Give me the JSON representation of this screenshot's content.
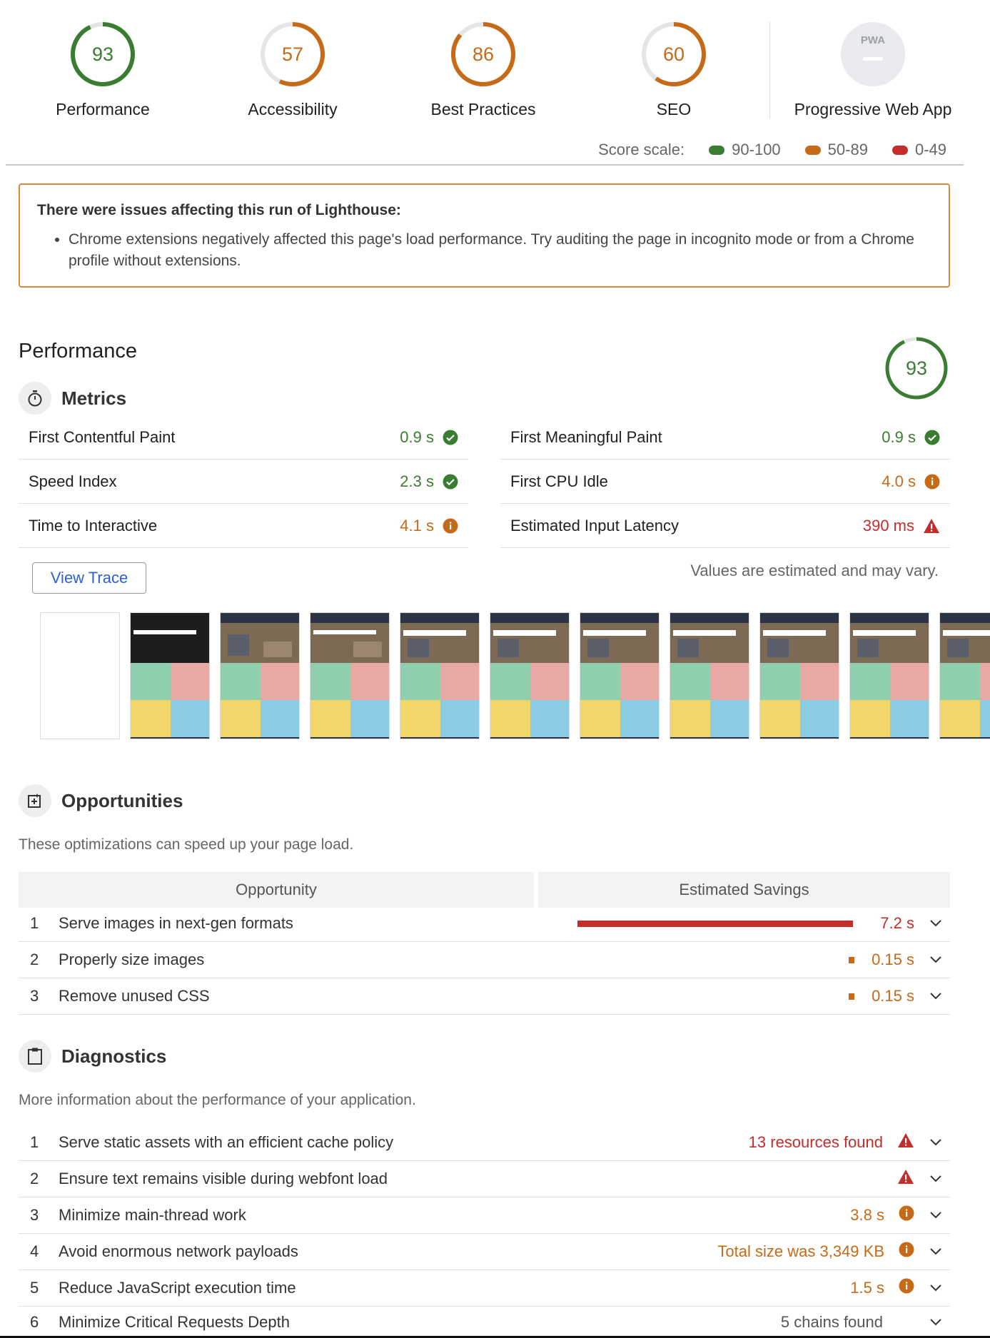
{
  "gauges": [
    {
      "score": "93",
      "label": "Performance",
      "color": "#3a7d32",
      "fraction": 0.93
    },
    {
      "score": "57",
      "label": "Accessibility",
      "color": "#c66a18",
      "fraction": 0.57
    },
    {
      "score": "86",
      "label": "Best Practices",
      "color": "#c66a18",
      "fraction": 0.86
    },
    {
      "score": "60",
      "label": "SEO",
      "color": "#c66a18",
      "fraction": 0.6
    }
  ],
  "pwa": {
    "badge": "PWA",
    "label": "Progressive Web App"
  },
  "scale": {
    "label": "Score scale:",
    "items": [
      {
        "range": "90-100",
        "color": "#3a7d32"
      },
      {
        "range": "50-89",
        "color": "#c66a18"
      },
      {
        "range": "0-49",
        "color": "#c42e2a"
      }
    ]
  },
  "warning": {
    "title": "There were issues affecting this run of Lighthouse:",
    "items": [
      "Chrome extensions negatively affected this page's load performance. Try auditing the page in incognito mode or from a Chrome profile without extensions."
    ]
  },
  "performance": {
    "title": "Performance",
    "score": "93"
  },
  "metrics": {
    "title": "Metrics",
    "left": [
      {
        "name": "First Contentful Paint",
        "value": "0.9 s",
        "status": "pass"
      },
      {
        "name": "Speed Index",
        "value": "2.3 s",
        "status": "pass"
      },
      {
        "name": "Time to Interactive",
        "value": "4.1 s",
        "status": "average"
      }
    ],
    "right": [
      {
        "name": "First Meaningful Paint",
        "value": "0.9 s",
        "status": "pass"
      },
      {
        "name": "First CPU Idle",
        "value": "4.0 s",
        "status": "average"
      },
      {
        "name": "Estimated Input Latency",
        "value": "390 ms",
        "status": "fail"
      }
    ],
    "view_trace": "View Trace",
    "note": "Values are estimated and may vary."
  },
  "opportunities": {
    "title": "Opportunities",
    "description": "These optimizations can speed up your page load.",
    "col_opportunity": "Opportunity",
    "col_savings": "Estimated Savings",
    "rows": [
      {
        "num": "1",
        "title": "Serve images in next-gen formats",
        "value": "7.2 s",
        "status": "fail",
        "bar_fraction": 1.0
      },
      {
        "num": "2",
        "title": "Properly size images",
        "value": "0.15 s",
        "status": "average",
        "bar_fraction": 0.02
      },
      {
        "num": "3",
        "title": "Remove unused CSS",
        "value": "0.15 s",
        "status": "average",
        "bar_fraction": 0.02
      }
    ]
  },
  "diagnostics": {
    "title": "Diagnostics",
    "description": "More information about the performance of your application.",
    "rows": [
      {
        "num": "1",
        "title": "Serve static assets with an efficient cache policy",
        "value": "13 resources found",
        "status": "fail"
      },
      {
        "num": "2",
        "title": "Ensure text remains visible during webfont load",
        "value": "",
        "status": "fail"
      },
      {
        "num": "3",
        "title": "Minimize main-thread work",
        "value": "3.8 s",
        "status": "average"
      },
      {
        "num": "4",
        "title": "Avoid enormous network payloads",
        "value": "Total size was 3,349 KB",
        "status": "average"
      },
      {
        "num": "5",
        "title": "Reduce JavaScript execution time",
        "value": "1.5 s",
        "status": "average"
      },
      {
        "num": "6",
        "title": "Minimize Critical Requests Depth",
        "value": "5 chains found",
        "status": "info"
      }
    ]
  }
}
